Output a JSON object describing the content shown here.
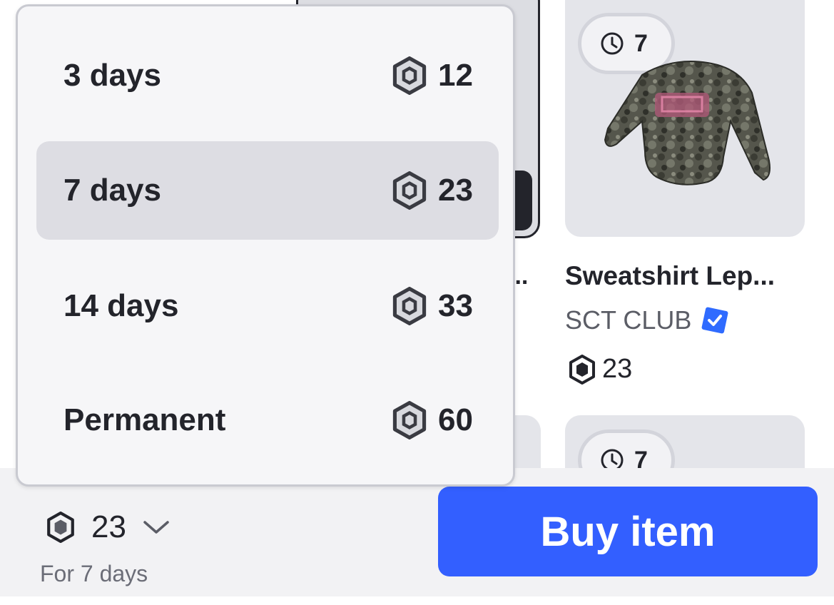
{
  "dropdown": {
    "options": [
      {
        "label": "3 days",
        "price": "12"
      },
      {
        "label": "7 days",
        "price": "23",
        "selected": true
      },
      {
        "label": "14 days",
        "price": "33"
      },
      {
        "label": "Permanent",
        "price": "60"
      }
    ]
  },
  "items": [
    {
      "timer": "7",
      "name": "Sweatshirt Lep...",
      "creator": "SCT CLUB",
      "creator_verified": true,
      "price": "23"
    },
    {
      "timer": "7"
    }
  ],
  "left_item": {
    "name_fragment": "..."
  },
  "footer": {
    "price": "23",
    "duration": "For 7 days",
    "buy_label": "Buy item"
  },
  "colors": {
    "accent": "#335fff",
    "verified": "#2f6bff",
    "selected_row": "#dddde3",
    "card_bg": "#e4e5ea"
  },
  "icons": [
    "robux-icon",
    "clock-icon",
    "chevron-down-icon",
    "verified-badge-icon"
  ]
}
